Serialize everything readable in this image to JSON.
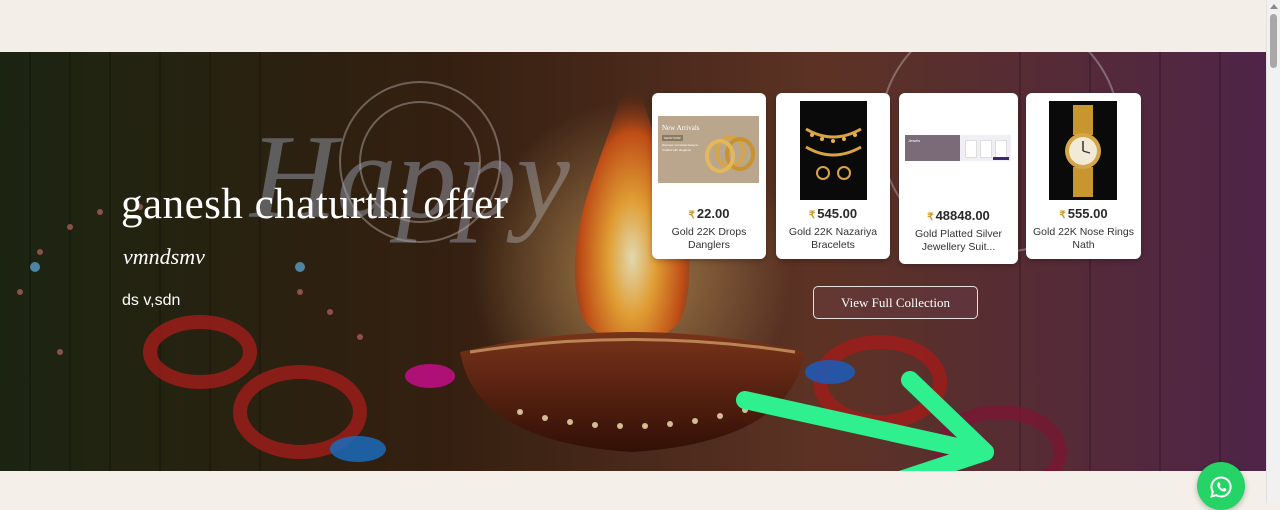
{
  "banner": {
    "title": "ganesh chaturthi offer",
    "subtitle": "vmndsmv",
    "description": "ds v,sdn",
    "background_text": "Happy"
  },
  "products": [
    {
      "price": "22.00",
      "name": "Gold 22K Drops Danglers",
      "image_text": {
        "heading": "New Arrivals",
        "badge": "SHOP NOW",
        "lines": [
          "Discover our latest designs",
          "Crafted with elegance"
        ]
      }
    },
    {
      "price": "545.00",
      "name": "Gold 22K Nazariya Bracelets"
    },
    {
      "price": "48848.00",
      "name": "Gold Platted Silver Jewellery Suit...",
      "image_text": {
        "heading": "Jewels"
      }
    },
    {
      "price": "555.00",
      "name": "Gold 22K Nose Rings Nath"
    }
  ],
  "currency_symbol": "₹",
  "view_collection_label": "View Full Collection",
  "icons": {
    "whatsapp": "whatsapp-icon",
    "annotation": "green-arrow-annotation"
  },
  "colors": {
    "whatsapp": "#25d366",
    "arrow": "#2ef08f",
    "gold": "#c89a2d",
    "page_bg": "#f4efe9"
  }
}
